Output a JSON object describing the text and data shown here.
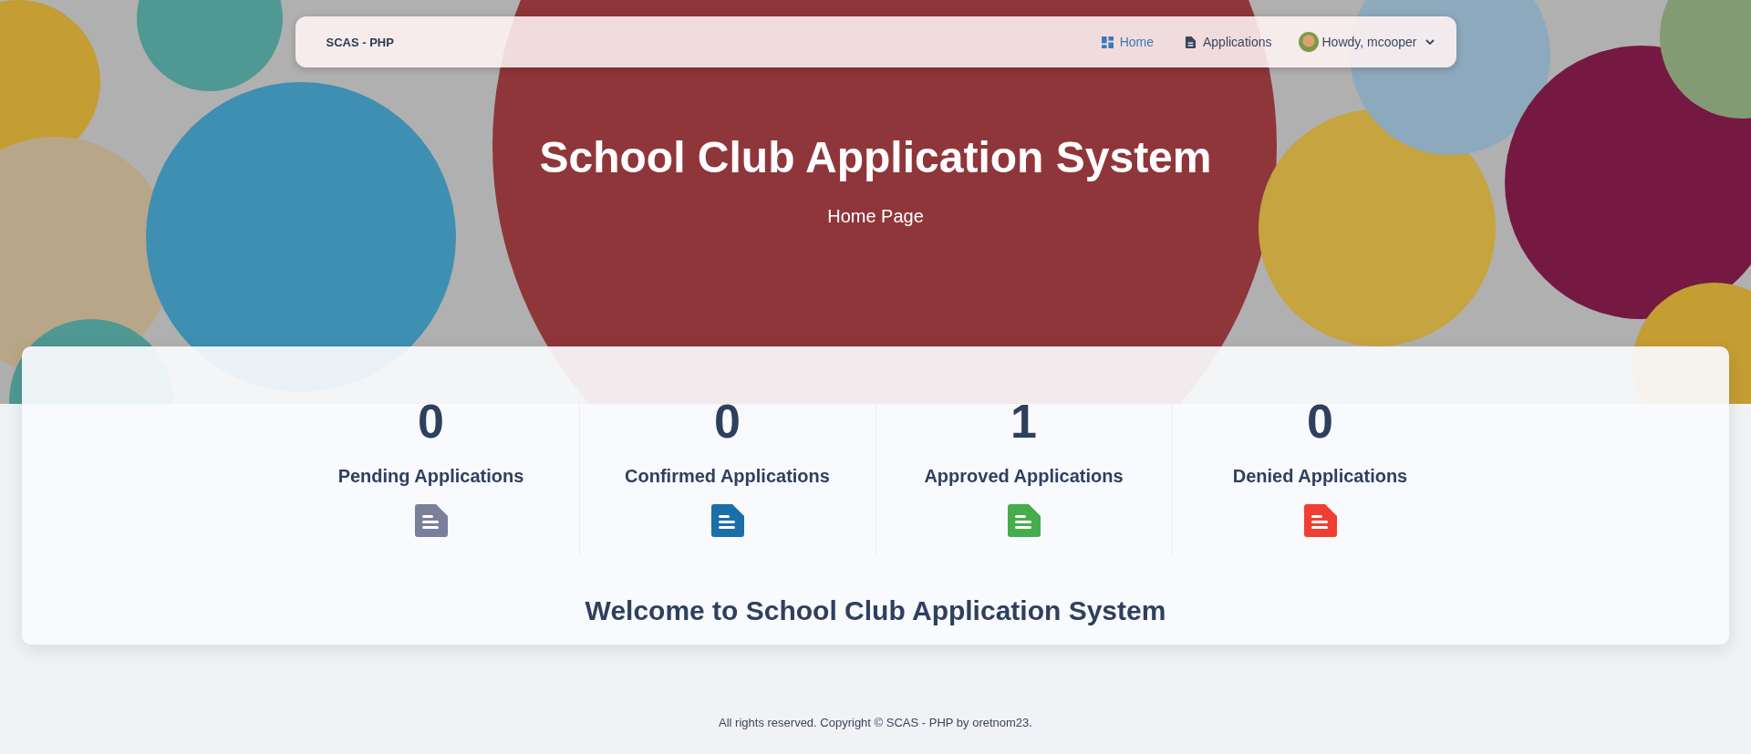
{
  "navbar": {
    "brand": "SCAS - PHP",
    "items": [
      {
        "label": "Home",
        "kind": "dashboard",
        "selected": true
      },
      {
        "label": "Applications",
        "kind": "list",
        "selected": false
      }
    ],
    "user": {
      "label": "Howdy, mcooper"
    }
  },
  "hero": {
    "kind": "picture",
    "title": "School Club Application System",
    "subtitle": "Home Page"
  },
  "stats": [
    {
      "count": "0",
      "label": "Pending Applications",
      "color": "#7a7f9a"
    },
    {
      "count": "0",
      "label": "Confirmed Applications",
      "color": "#1a6fa8"
    },
    {
      "count": "1",
      "label": "Approved Applications",
      "color": "#45ad4a"
    },
    {
      "count": "0",
      "label": "Denied Applications",
      "color": "#f03e33"
    }
  ],
  "welcome": "Welcome to School Club Application System",
  "footer": "All rights reserved. Copyright © SCAS - PHP by oretnom23."
}
